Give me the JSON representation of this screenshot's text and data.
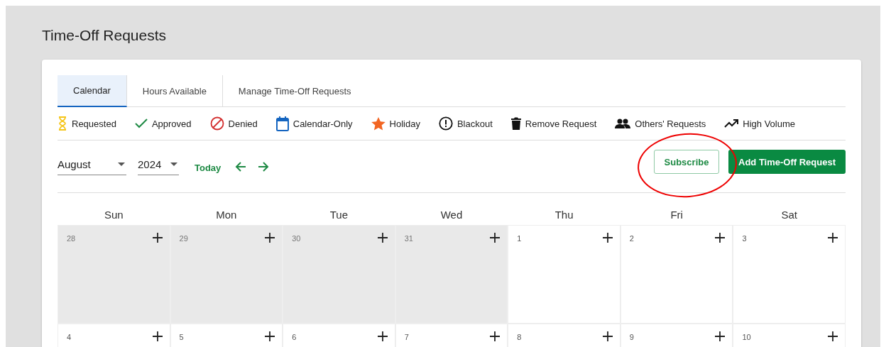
{
  "page_title": "Time-Off Requests",
  "tabs": [
    {
      "label": "Calendar",
      "selected": true
    },
    {
      "label": "Hours Available",
      "selected": false
    },
    {
      "label": "Manage Time-Off Requests",
      "selected": false
    }
  ],
  "legend": [
    {
      "kind": "requested",
      "label": "Requested"
    },
    {
      "kind": "approved",
      "label": "Approved"
    },
    {
      "kind": "denied",
      "label": "Denied"
    },
    {
      "kind": "calendar",
      "label": "Calendar-Only"
    },
    {
      "kind": "holiday",
      "label": "Holiday"
    },
    {
      "kind": "blackout",
      "label": "Blackout"
    },
    {
      "kind": "remove",
      "label": "Remove Request"
    },
    {
      "kind": "others",
      "label": "Others' Requests"
    },
    {
      "kind": "volume",
      "label": "High Volume"
    }
  ],
  "month_select": {
    "value": "August"
  },
  "year_select": {
    "value": "2024"
  },
  "today_button": "Today",
  "subscribe_button": {
    "label": "Subscribe",
    "circled": true
  },
  "add_button": "Add Time-Off Request",
  "weekdays": [
    "Sun",
    "Mon",
    "Tue",
    "Wed",
    "Thu",
    "Fri",
    "Sat"
  ],
  "weeks": [
    [
      {
        "day": "28",
        "in_month": false
      },
      {
        "day": "29",
        "in_month": false
      },
      {
        "day": "30",
        "in_month": false
      },
      {
        "day": "31",
        "in_month": false
      },
      {
        "day": "1",
        "in_month": true
      },
      {
        "day": "2",
        "in_month": true
      },
      {
        "day": "3",
        "in_month": true
      }
    ],
    [
      {
        "day": "4",
        "in_month": true
      },
      {
        "day": "5",
        "in_month": true
      },
      {
        "day": "6",
        "in_month": true
      },
      {
        "day": "7",
        "in_month": true
      },
      {
        "day": "8",
        "in_month": true
      },
      {
        "day": "9",
        "in_month": true
      },
      {
        "day": "10",
        "in_month": true
      }
    ]
  ]
}
